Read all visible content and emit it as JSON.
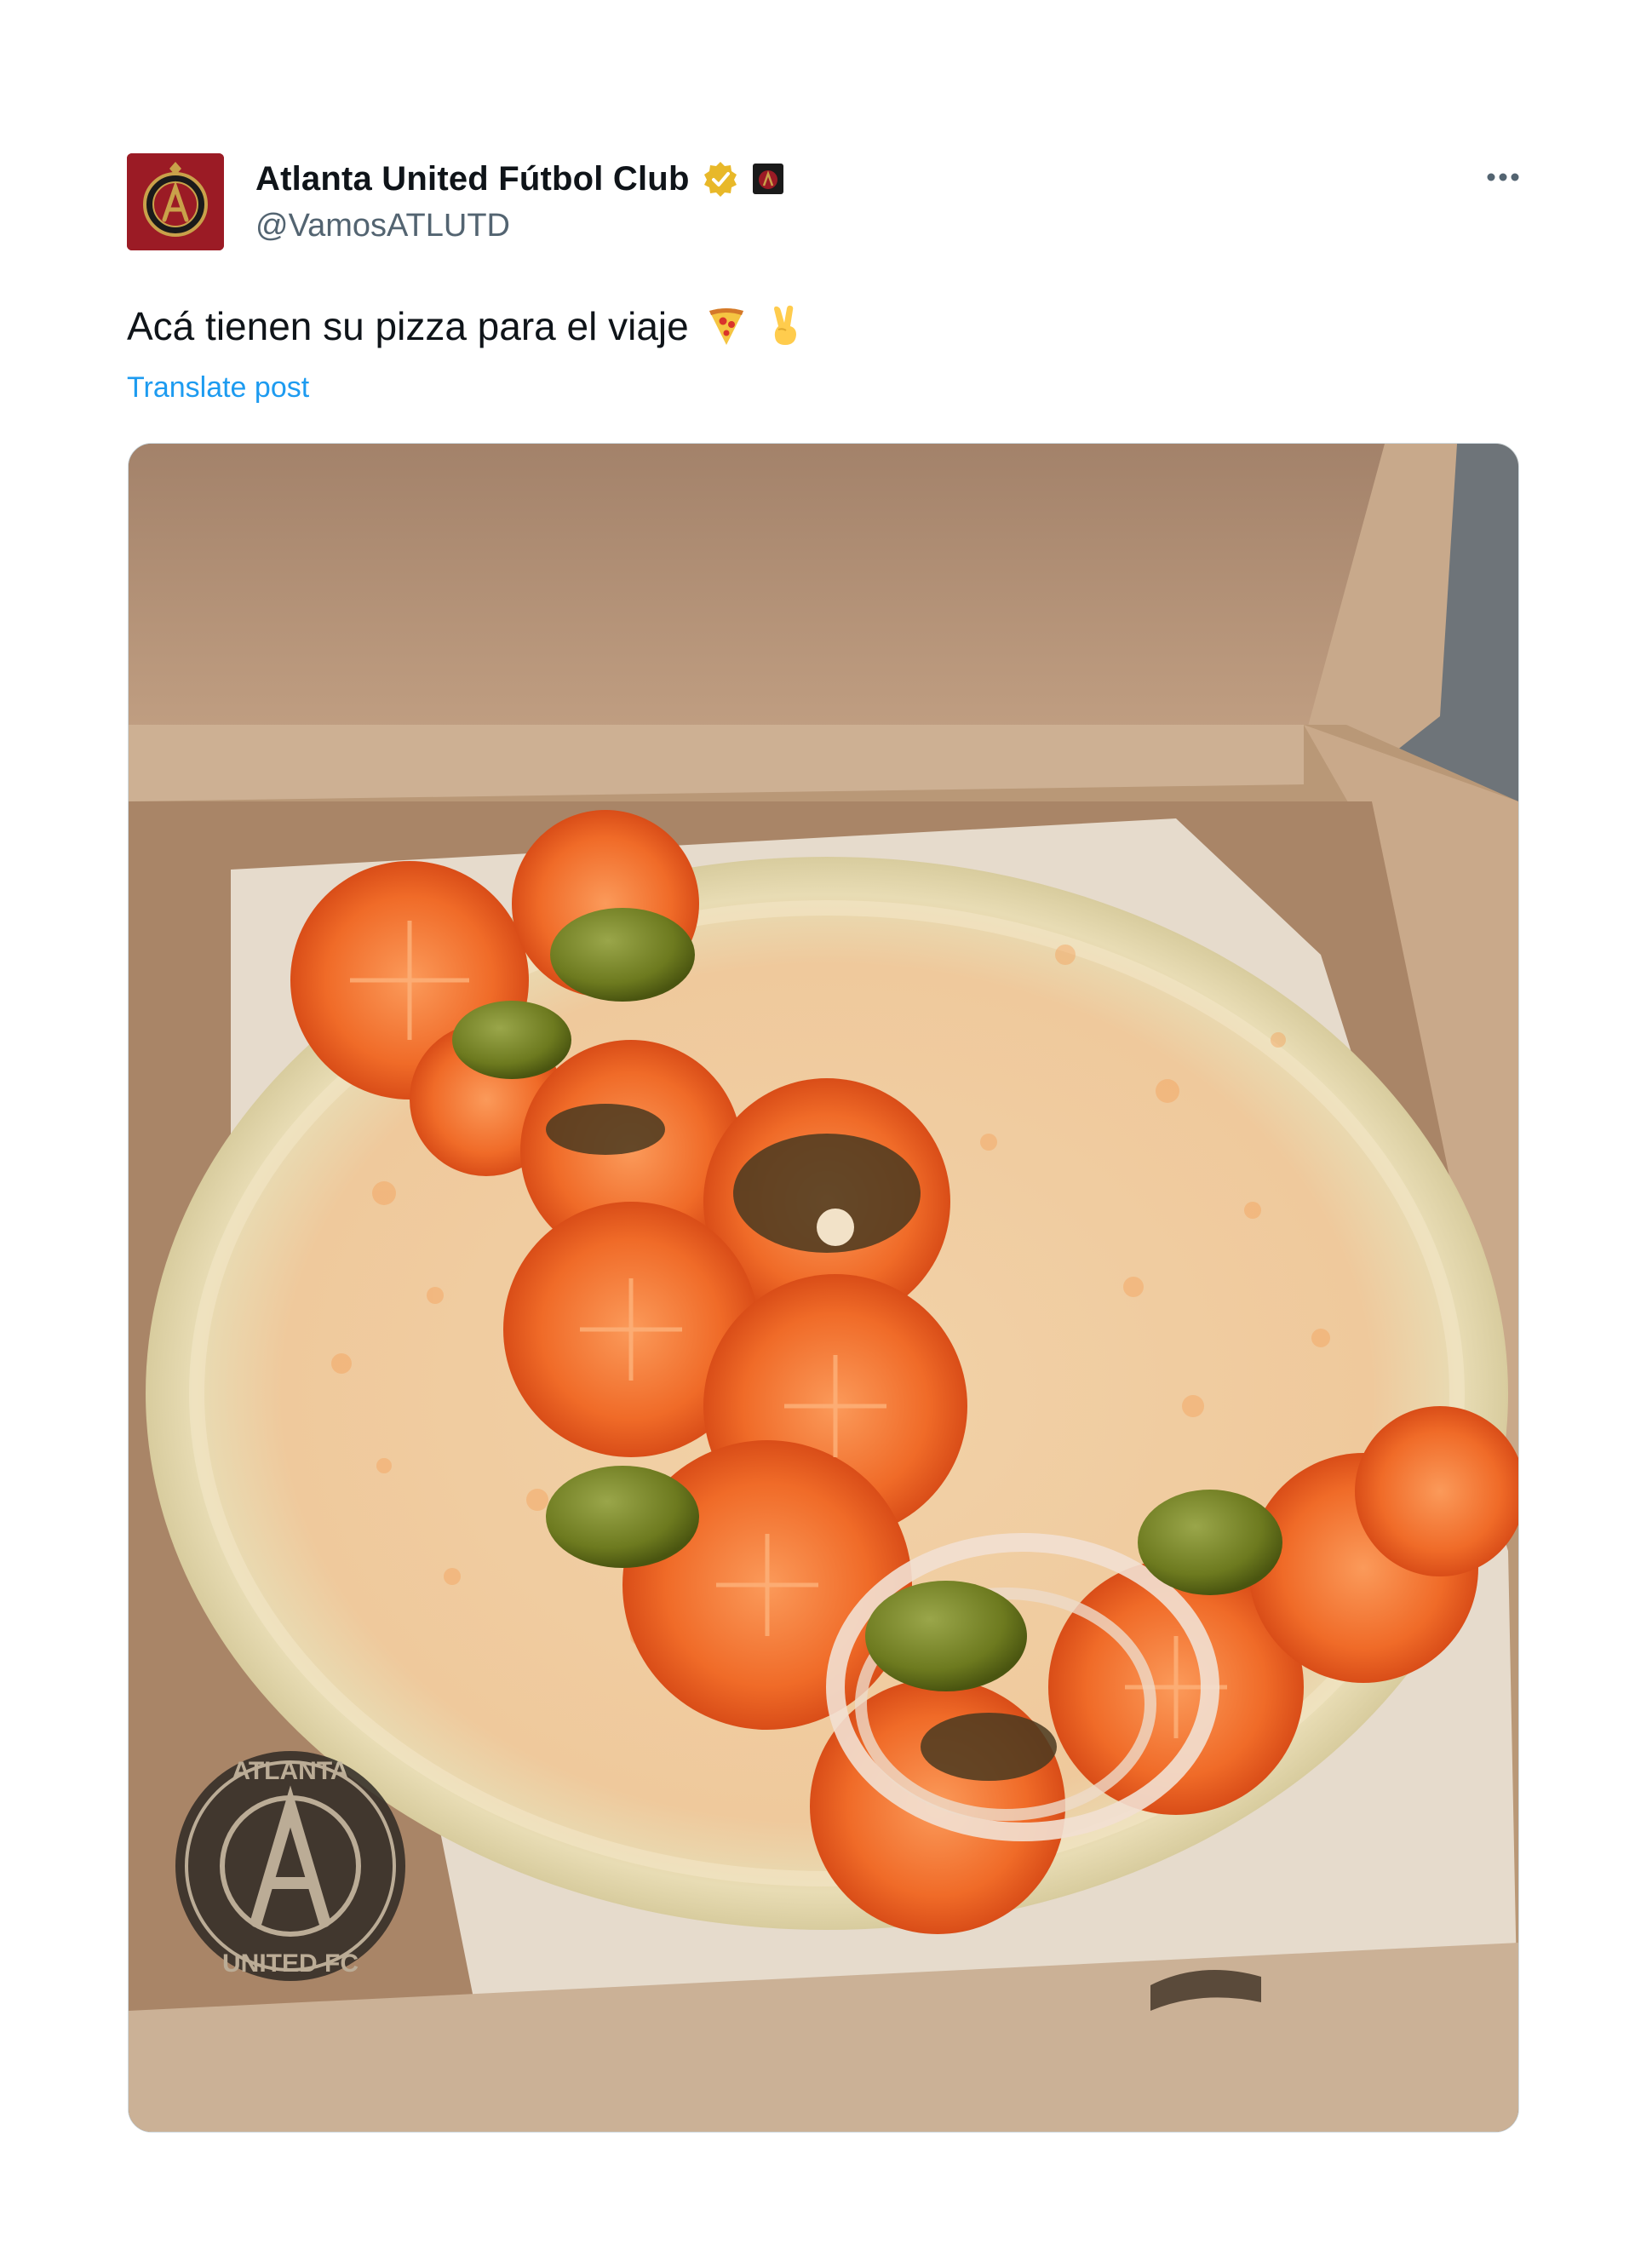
{
  "tweet": {
    "display_name": "Atlanta United Fútbol Club",
    "handle": "@VamosATLUTD",
    "text": "Acá tienen su pizza para el viaje",
    "translate_label": "Translate post",
    "emojis": [
      "pizza-emoji",
      "victory-hand-emoji"
    ],
    "verified": true,
    "more_icon": "more-horizontal-icon"
  },
  "media": {
    "logo_text_top": "ATLANTA",
    "logo_text_bottom": "UNITED FC"
  },
  "colors": {
    "brand_red": "#9b1b25",
    "gold": "#c9a14a",
    "link_blue": "#1d9bf0",
    "handle_gray": "#536471",
    "badge_gold": "#e8b829"
  }
}
